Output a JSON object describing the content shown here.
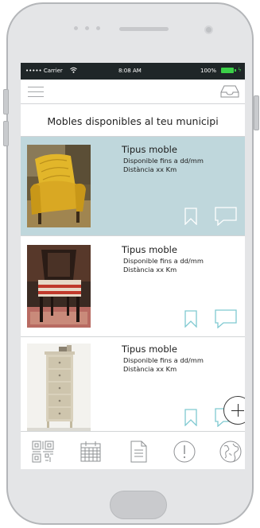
{
  "status_bar": {
    "carrier": "••••• Carrier",
    "time": "8:08 AM",
    "battery": "100%"
  },
  "header": {
    "title": "Mobles disponibles al teu municipi"
  },
  "listings": [
    {
      "type": "Tipus moble",
      "availability": "Disponible fins a dd/mm",
      "distance": "Distància xx Km",
      "highlighted": true,
      "image": "yellow-armchair"
    },
    {
      "type": "Tipus moble",
      "availability": "Disponible fins a dd/mm",
      "distance": "Distància xx Km",
      "highlighted": false,
      "image": "striped-chair"
    },
    {
      "type": "Tipus moble",
      "availability": "Disponible fins a dd/mm",
      "distance": "Distància xx Km",
      "highlighted": false,
      "image": "chest-of-drawers"
    }
  ],
  "tabbar": {
    "items": [
      "qr-code-icon",
      "calendar-icon",
      "document-icon",
      "alert-icon",
      "globe-icon"
    ]
  },
  "colors": {
    "highlight": "#bfd7dc",
    "accent_icon": "#7fc9d1",
    "status_bar": "#1f2628",
    "battery": "#3bcf48"
  }
}
